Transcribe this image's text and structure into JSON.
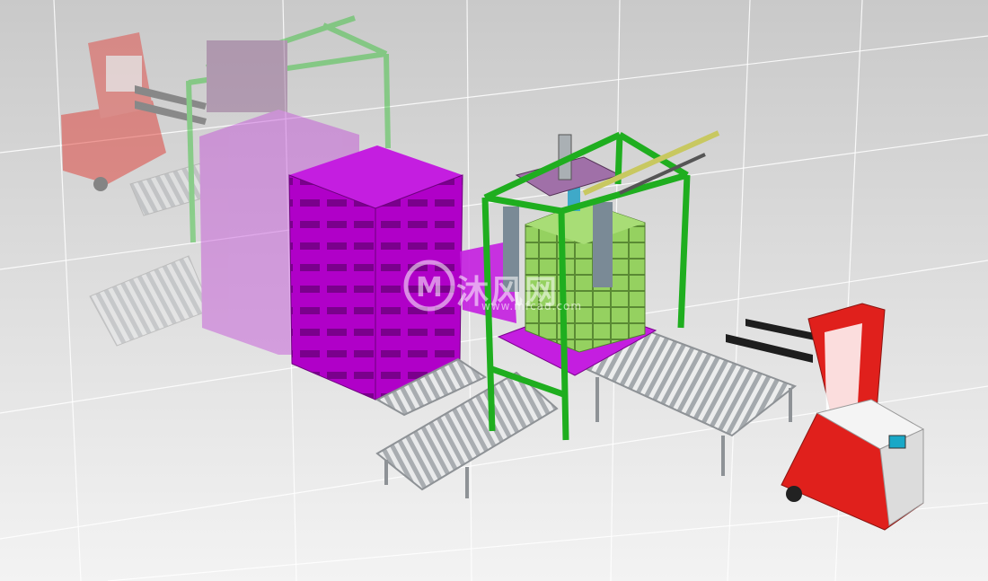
{
  "scene": {
    "description_colors": {
      "background_top": "#c9c9c9",
      "background_bottom": "#f2f2f2",
      "pallet_magenta": "#b000c8",
      "frame_green": "#2ec12e",
      "agv_red": "#e0201c",
      "cargo_green": "#8fcf5a",
      "roller_gray": "#bfc4c8"
    },
    "icons": [
      "agv-forklift-icon",
      "palletizer-frame-icon",
      "roller-conveyor-icon",
      "pallet-stack-icon"
    ]
  },
  "watermark": {
    "text": "沐风网",
    "url": "www.mfcad.com"
  }
}
